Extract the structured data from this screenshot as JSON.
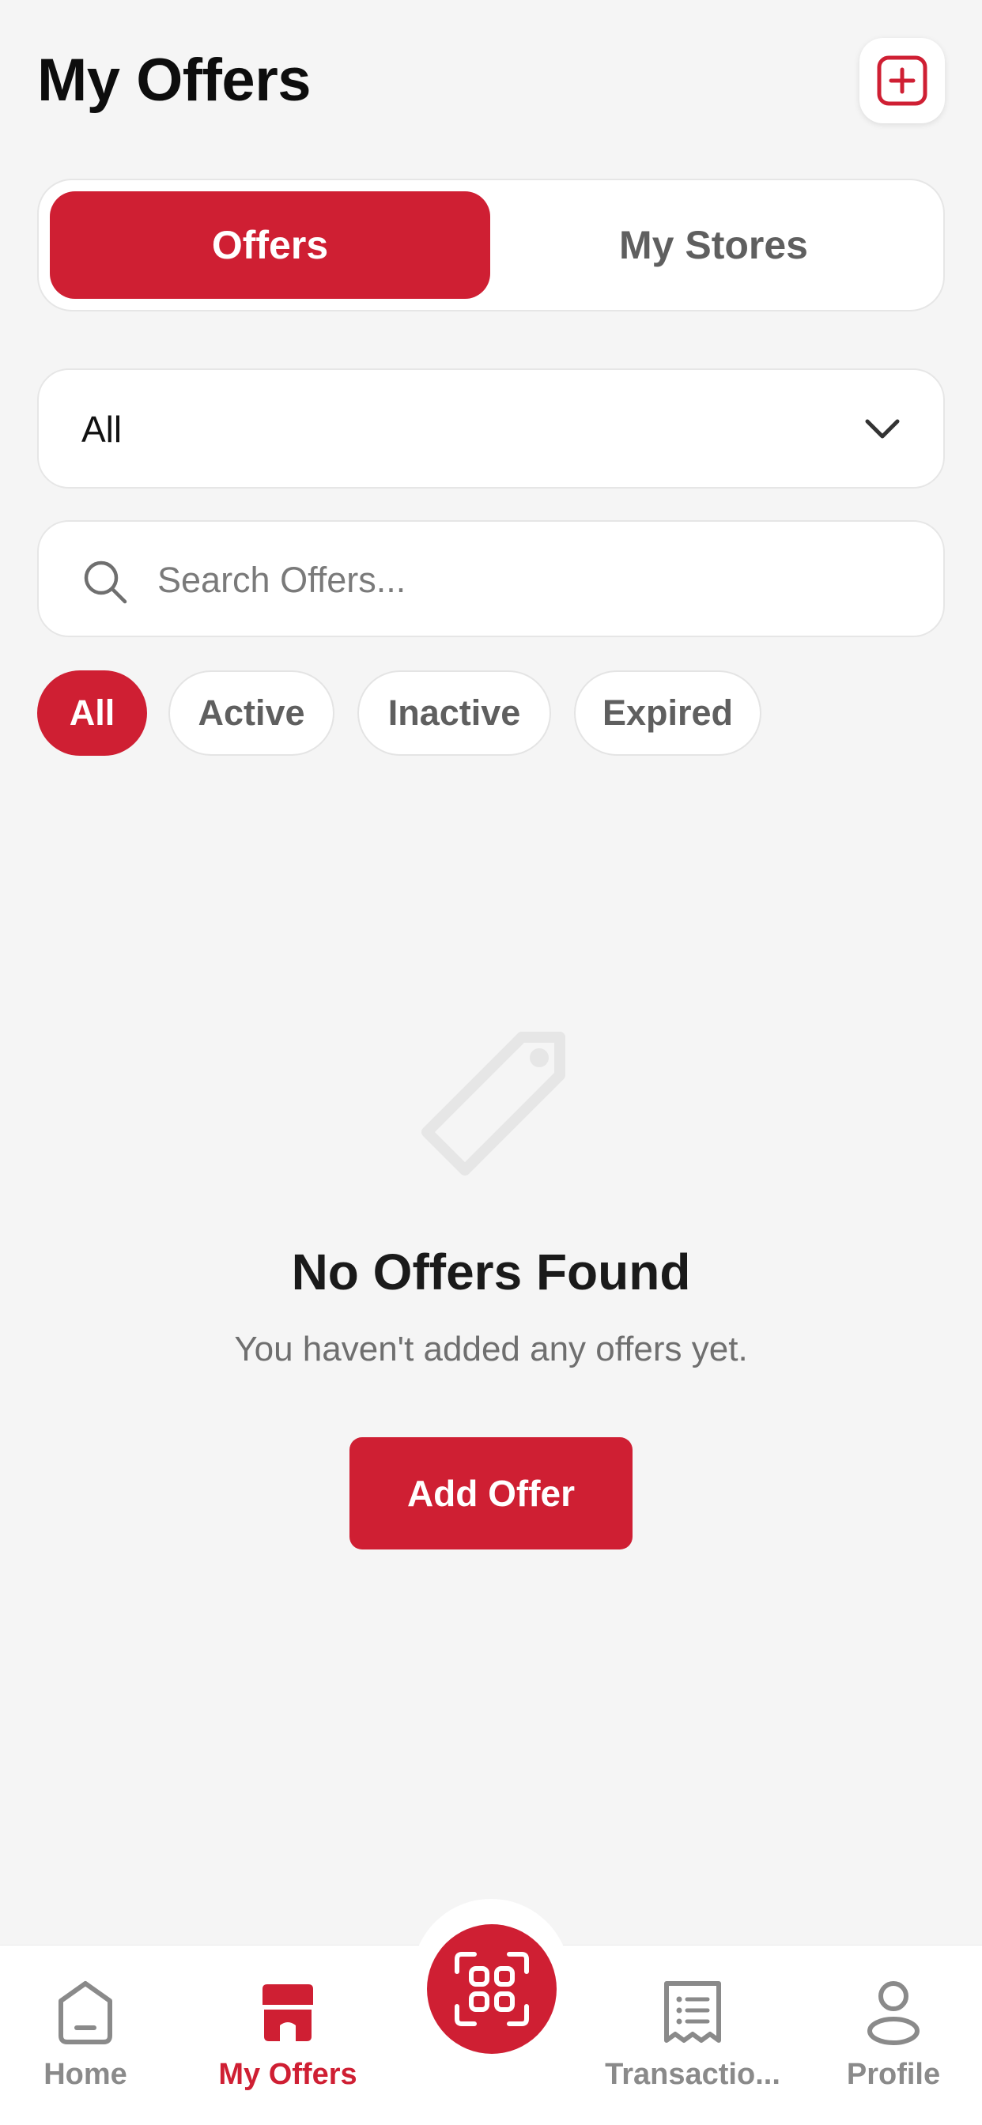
{
  "header": {
    "title": "My Offers",
    "add_icon": "plus-square-icon"
  },
  "tabs": [
    {
      "label": "Offers",
      "active": true
    },
    {
      "label": "My Stores",
      "active": false
    }
  ],
  "filter_dropdown": {
    "value": "All",
    "icon": "chevron-down-icon"
  },
  "search": {
    "placeholder": "Search Offers...",
    "value": ""
  },
  "status_chips": [
    {
      "label": "All",
      "selected": true
    },
    {
      "label": "Active",
      "selected": false
    },
    {
      "label": "Inactive",
      "selected": false
    },
    {
      "label": "Expired",
      "selected": false
    }
  ],
  "empty_state": {
    "icon": "tag-icon",
    "title": "No Offers Found",
    "subtitle": "You haven't added any offers yet.",
    "button_label": "Add Offer"
  },
  "bottom_nav": {
    "items": [
      {
        "label": "Home",
        "icon": "home-icon",
        "active": false
      },
      {
        "label": "My Offers",
        "icon": "store-icon",
        "active": true
      },
      {
        "label": "Transactio...",
        "icon": "receipt-icon",
        "active": false
      },
      {
        "label": "Profile",
        "icon": "profile-icon",
        "active": false
      }
    ],
    "center_icon": "qr-scan-icon"
  },
  "colors": {
    "accent": "#cf1f33",
    "background": "#f5f5f5",
    "muted_text": "#5f5f5f"
  }
}
